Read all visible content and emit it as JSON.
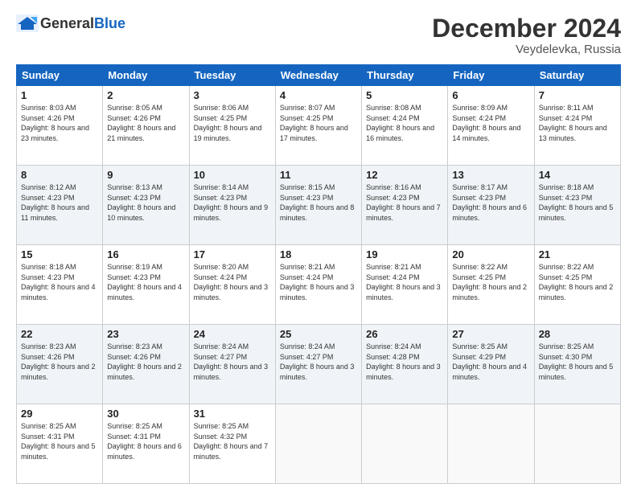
{
  "logo": {
    "general": "General",
    "blue": "Blue"
  },
  "title": "December 2024",
  "location": "Veydelevka, Russia",
  "days_of_week": [
    "Sunday",
    "Monday",
    "Tuesday",
    "Wednesday",
    "Thursday",
    "Friday",
    "Saturday"
  ],
  "weeks": [
    [
      {
        "day": "1",
        "sunrise": "8:03 AM",
        "sunset": "4:26 PM",
        "daylight": "8 hours and 23 minutes."
      },
      {
        "day": "2",
        "sunrise": "8:05 AM",
        "sunset": "4:26 PM",
        "daylight": "8 hours and 21 minutes."
      },
      {
        "day": "3",
        "sunrise": "8:06 AM",
        "sunset": "4:25 PM",
        "daylight": "8 hours and 19 minutes."
      },
      {
        "day": "4",
        "sunrise": "8:07 AM",
        "sunset": "4:25 PM",
        "daylight": "8 hours and 17 minutes."
      },
      {
        "day": "5",
        "sunrise": "8:08 AM",
        "sunset": "4:24 PM",
        "daylight": "8 hours and 16 minutes."
      },
      {
        "day": "6",
        "sunrise": "8:09 AM",
        "sunset": "4:24 PM",
        "daylight": "8 hours and 14 minutes."
      },
      {
        "day": "7",
        "sunrise": "8:11 AM",
        "sunset": "4:24 PM",
        "daylight": "8 hours and 13 minutes."
      }
    ],
    [
      {
        "day": "8",
        "sunrise": "8:12 AM",
        "sunset": "4:23 PM",
        "daylight": "8 hours and 11 minutes."
      },
      {
        "day": "9",
        "sunrise": "8:13 AM",
        "sunset": "4:23 PM",
        "daylight": "8 hours and 10 minutes."
      },
      {
        "day": "10",
        "sunrise": "8:14 AM",
        "sunset": "4:23 PM",
        "daylight": "8 hours and 9 minutes."
      },
      {
        "day": "11",
        "sunrise": "8:15 AM",
        "sunset": "4:23 PM",
        "daylight": "8 hours and 8 minutes."
      },
      {
        "day": "12",
        "sunrise": "8:16 AM",
        "sunset": "4:23 PM",
        "daylight": "8 hours and 7 minutes."
      },
      {
        "day": "13",
        "sunrise": "8:17 AM",
        "sunset": "4:23 PM",
        "daylight": "8 hours and 6 minutes."
      },
      {
        "day": "14",
        "sunrise": "8:18 AM",
        "sunset": "4:23 PM",
        "daylight": "8 hours and 5 minutes."
      }
    ],
    [
      {
        "day": "15",
        "sunrise": "8:18 AM",
        "sunset": "4:23 PM",
        "daylight": "8 hours and 4 minutes."
      },
      {
        "day": "16",
        "sunrise": "8:19 AM",
        "sunset": "4:23 PM",
        "daylight": "8 hours and 4 minutes."
      },
      {
        "day": "17",
        "sunrise": "8:20 AM",
        "sunset": "4:24 PM",
        "daylight": "8 hours and 3 minutes."
      },
      {
        "day": "18",
        "sunrise": "8:21 AM",
        "sunset": "4:24 PM",
        "daylight": "8 hours and 3 minutes."
      },
      {
        "day": "19",
        "sunrise": "8:21 AM",
        "sunset": "4:24 PM",
        "daylight": "8 hours and 3 minutes."
      },
      {
        "day": "20",
        "sunrise": "8:22 AM",
        "sunset": "4:25 PM",
        "daylight": "8 hours and 2 minutes."
      },
      {
        "day": "21",
        "sunrise": "8:22 AM",
        "sunset": "4:25 PM",
        "daylight": "8 hours and 2 minutes."
      }
    ],
    [
      {
        "day": "22",
        "sunrise": "8:23 AM",
        "sunset": "4:26 PM",
        "daylight": "8 hours and 2 minutes."
      },
      {
        "day": "23",
        "sunrise": "8:23 AM",
        "sunset": "4:26 PM",
        "daylight": "8 hours and 2 minutes."
      },
      {
        "day": "24",
        "sunrise": "8:24 AM",
        "sunset": "4:27 PM",
        "daylight": "8 hours and 3 minutes."
      },
      {
        "day": "25",
        "sunrise": "8:24 AM",
        "sunset": "4:27 PM",
        "daylight": "8 hours and 3 minutes."
      },
      {
        "day": "26",
        "sunrise": "8:24 AM",
        "sunset": "4:28 PM",
        "daylight": "8 hours and 3 minutes."
      },
      {
        "day": "27",
        "sunrise": "8:25 AM",
        "sunset": "4:29 PM",
        "daylight": "8 hours and 4 minutes."
      },
      {
        "day": "28",
        "sunrise": "8:25 AM",
        "sunset": "4:30 PM",
        "daylight": "8 hours and 5 minutes."
      }
    ],
    [
      {
        "day": "29",
        "sunrise": "8:25 AM",
        "sunset": "4:31 PM",
        "daylight": "8 hours and 5 minutes."
      },
      {
        "day": "30",
        "sunrise": "8:25 AM",
        "sunset": "4:31 PM",
        "daylight": "8 hours and 6 minutes."
      },
      {
        "day": "31",
        "sunrise": "8:25 AM",
        "sunset": "4:32 PM",
        "daylight": "8 hours and 7 minutes."
      },
      null,
      null,
      null,
      null
    ]
  ]
}
